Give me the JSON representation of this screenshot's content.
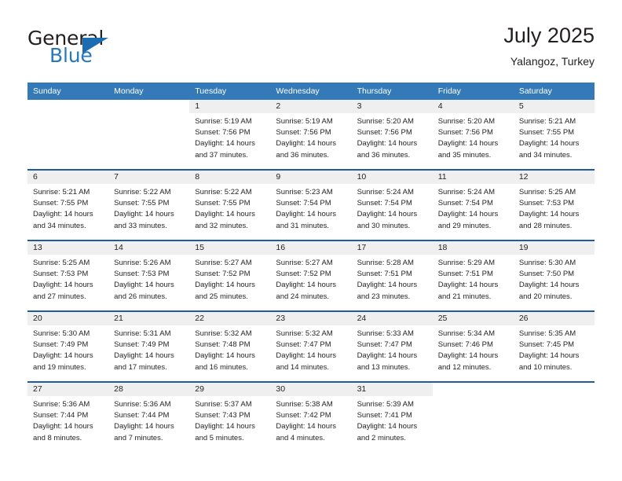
{
  "brand": {
    "word_one": "General",
    "word_two": "Blue",
    "triangle_color": "#1b6cb3",
    "text_color": "#2679bd"
  },
  "header": {
    "title": "July 2025",
    "subtitle": "Yalangoz, Turkey"
  },
  "colors": {
    "header_blue": "#3479b8",
    "separator_blue": "#1f5c9e",
    "daynum_band": "#efefef",
    "text": "#231f20"
  },
  "weekday_headers": [
    "Sunday",
    "Monday",
    "Tuesday",
    "Wednesday",
    "Thursday",
    "Friday",
    "Saturday"
  ],
  "labels": {
    "sunrise_prefix": "Sunrise:",
    "sunset_prefix": "Sunset:",
    "daylight_prefix": "Daylight:"
  },
  "weeks": [
    [
      {
        "day": "",
        "sunrise": "",
        "sunset": "",
        "daylight": ""
      },
      {
        "day": "",
        "sunrise": "",
        "sunset": "",
        "daylight": ""
      },
      {
        "day": "1",
        "sunrise": "Sunrise: 5:19 AM",
        "sunset": "Sunset: 7:56 PM",
        "daylight": "Daylight: 14 hours and 37 minutes."
      },
      {
        "day": "2",
        "sunrise": "Sunrise: 5:19 AM",
        "sunset": "Sunset: 7:56 PM",
        "daylight": "Daylight: 14 hours and 36 minutes."
      },
      {
        "day": "3",
        "sunrise": "Sunrise: 5:20 AM",
        "sunset": "Sunset: 7:56 PM",
        "daylight": "Daylight: 14 hours and 36 minutes."
      },
      {
        "day": "4",
        "sunrise": "Sunrise: 5:20 AM",
        "sunset": "Sunset: 7:56 PM",
        "daylight": "Daylight: 14 hours and 35 minutes."
      },
      {
        "day": "5",
        "sunrise": "Sunrise: 5:21 AM",
        "sunset": "Sunset: 7:55 PM",
        "daylight": "Daylight: 14 hours and 34 minutes."
      }
    ],
    [
      {
        "day": "6",
        "sunrise": "Sunrise: 5:21 AM",
        "sunset": "Sunset: 7:55 PM",
        "daylight": "Daylight: 14 hours and 34 minutes."
      },
      {
        "day": "7",
        "sunrise": "Sunrise: 5:22 AM",
        "sunset": "Sunset: 7:55 PM",
        "daylight": "Daylight: 14 hours and 33 minutes."
      },
      {
        "day": "8",
        "sunrise": "Sunrise: 5:22 AM",
        "sunset": "Sunset: 7:55 PM",
        "daylight": "Daylight: 14 hours and 32 minutes."
      },
      {
        "day": "9",
        "sunrise": "Sunrise: 5:23 AM",
        "sunset": "Sunset: 7:54 PM",
        "daylight": "Daylight: 14 hours and 31 minutes."
      },
      {
        "day": "10",
        "sunrise": "Sunrise: 5:24 AM",
        "sunset": "Sunset: 7:54 PM",
        "daylight": "Daylight: 14 hours and 30 minutes."
      },
      {
        "day": "11",
        "sunrise": "Sunrise: 5:24 AM",
        "sunset": "Sunset: 7:54 PM",
        "daylight": "Daylight: 14 hours and 29 minutes."
      },
      {
        "day": "12",
        "sunrise": "Sunrise: 5:25 AM",
        "sunset": "Sunset: 7:53 PM",
        "daylight": "Daylight: 14 hours and 28 minutes."
      }
    ],
    [
      {
        "day": "13",
        "sunrise": "Sunrise: 5:25 AM",
        "sunset": "Sunset: 7:53 PM",
        "daylight": "Daylight: 14 hours and 27 minutes."
      },
      {
        "day": "14",
        "sunrise": "Sunrise: 5:26 AM",
        "sunset": "Sunset: 7:53 PM",
        "daylight": "Daylight: 14 hours and 26 minutes."
      },
      {
        "day": "15",
        "sunrise": "Sunrise: 5:27 AM",
        "sunset": "Sunset: 7:52 PM",
        "daylight": "Daylight: 14 hours and 25 minutes."
      },
      {
        "day": "16",
        "sunrise": "Sunrise: 5:27 AM",
        "sunset": "Sunset: 7:52 PM",
        "daylight": "Daylight: 14 hours and 24 minutes."
      },
      {
        "day": "17",
        "sunrise": "Sunrise: 5:28 AM",
        "sunset": "Sunset: 7:51 PM",
        "daylight": "Daylight: 14 hours and 23 minutes."
      },
      {
        "day": "18",
        "sunrise": "Sunrise: 5:29 AM",
        "sunset": "Sunset: 7:51 PM",
        "daylight": "Daylight: 14 hours and 21 minutes."
      },
      {
        "day": "19",
        "sunrise": "Sunrise: 5:30 AM",
        "sunset": "Sunset: 7:50 PM",
        "daylight": "Daylight: 14 hours and 20 minutes."
      }
    ],
    [
      {
        "day": "20",
        "sunrise": "Sunrise: 5:30 AM",
        "sunset": "Sunset: 7:49 PM",
        "daylight": "Daylight: 14 hours and 19 minutes."
      },
      {
        "day": "21",
        "sunrise": "Sunrise: 5:31 AM",
        "sunset": "Sunset: 7:49 PM",
        "daylight": "Daylight: 14 hours and 17 minutes."
      },
      {
        "day": "22",
        "sunrise": "Sunrise: 5:32 AM",
        "sunset": "Sunset: 7:48 PM",
        "daylight": "Daylight: 14 hours and 16 minutes."
      },
      {
        "day": "23",
        "sunrise": "Sunrise: 5:32 AM",
        "sunset": "Sunset: 7:47 PM",
        "daylight": "Daylight: 14 hours and 14 minutes."
      },
      {
        "day": "24",
        "sunrise": "Sunrise: 5:33 AM",
        "sunset": "Sunset: 7:47 PM",
        "daylight": "Daylight: 14 hours and 13 minutes."
      },
      {
        "day": "25",
        "sunrise": "Sunrise: 5:34 AM",
        "sunset": "Sunset: 7:46 PM",
        "daylight": "Daylight: 14 hours and 12 minutes."
      },
      {
        "day": "26",
        "sunrise": "Sunrise: 5:35 AM",
        "sunset": "Sunset: 7:45 PM",
        "daylight": "Daylight: 14 hours and 10 minutes."
      }
    ],
    [
      {
        "day": "27",
        "sunrise": "Sunrise: 5:36 AM",
        "sunset": "Sunset: 7:44 PM",
        "daylight": "Daylight: 14 hours and 8 minutes."
      },
      {
        "day": "28",
        "sunrise": "Sunrise: 5:36 AM",
        "sunset": "Sunset: 7:44 PM",
        "daylight": "Daylight: 14 hours and 7 minutes."
      },
      {
        "day": "29",
        "sunrise": "Sunrise: 5:37 AM",
        "sunset": "Sunset: 7:43 PM",
        "daylight": "Daylight: 14 hours and 5 minutes."
      },
      {
        "day": "30",
        "sunrise": "Sunrise: 5:38 AM",
        "sunset": "Sunset: 7:42 PM",
        "daylight": "Daylight: 14 hours and 4 minutes."
      },
      {
        "day": "31",
        "sunrise": "Sunrise: 5:39 AM",
        "sunset": "Sunset: 7:41 PM",
        "daylight": "Daylight: 14 hours and 2 minutes."
      },
      {
        "day": "",
        "sunrise": "",
        "sunset": "",
        "daylight": ""
      },
      {
        "day": "",
        "sunrise": "",
        "sunset": "",
        "daylight": ""
      }
    ]
  ]
}
